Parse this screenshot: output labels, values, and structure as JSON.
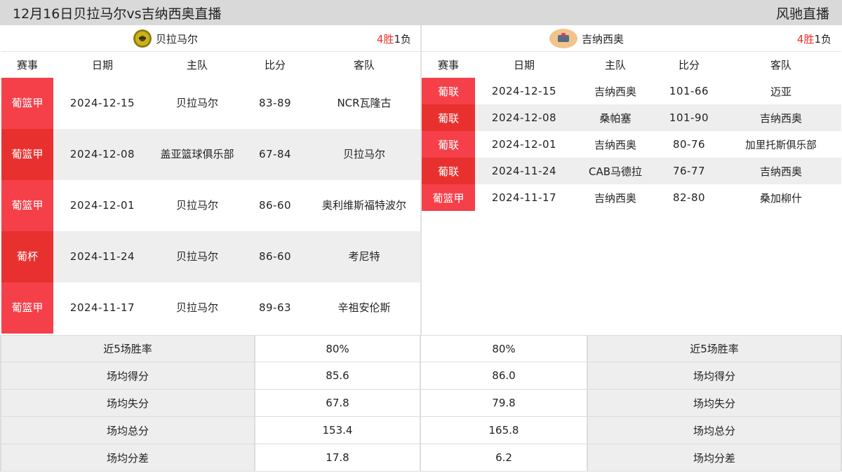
{
  "header": {
    "title": "12月16日贝拉马尔vs吉纳西奥直播",
    "brand": "风驰直播"
  },
  "columns": [
    "赛事",
    "日期",
    "主队",
    "比分",
    "客队"
  ],
  "left_team": {
    "name": "贝拉马尔",
    "logo_icon": "belamar-crest-icon",
    "record": {
      "wins": "4",
      "win_label": "胜",
      "losses": "1",
      "loss_label": "负"
    },
    "matches": [
      {
        "league": "葡篮甲",
        "date": "2024-12-15",
        "home": "贝拉马尔",
        "score": "83-89",
        "away": "NCR瓦隆古"
      },
      {
        "league": "葡篮甲",
        "date": "2024-12-08",
        "home": "盖亚篮球俱乐部",
        "score": "67-84",
        "away": "贝拉马尔"
      },
      {
        "league": "葡篮甲",
        "date": "2024-12-01",
        "home": "贝拉马尔",
        "score": "86-60",
        "away": "奥利维斯福特波尔"
      },
      {
        "league": "葡杯",
        "date": "2024-11-24",
        "home": "贝拉马尔",
        "score": "86-60",
        "away": "考尼特"
      },
      {
        "league": "葡篮甲",
        "date": "2024-11-17",
        "home": "贝拉马尔",
        "score": "89-63",
        "away": "辛祖安伦斯"
      }
    ]
  },
  "right_team": {
    "name": "吉纳西奥",
    "logo_icon": "guimar-crest-icon",
    "record": {
      "wins": "4",
      "win_label": "胜",
      "losses": "1",
      "loss_label": "负"
    },
    "matches": [
      {
        "league": "葡联",
        "date": "2024-12-15",
        "home": "吉纳西奥",
        "score": "101-66",
        "away": "迈亚"
      },
      {
        "league": "葡联",
        "date": "2024-12-08",
        "home": "桑帕塞",
        "score": "101-90",
        "away": "吉纳西奥"
      },
      {
        "league": "葡联",
        "date": "2024-12-01",
        "home": "吉纳西奥",
        "score": "80-76",
        "away": "加里托斯俱乐部"
      },
      {
        "league": "葡联",
        "date": "2024-11-24",
        "home": "CAB马德拉",
        "score": "76-77",
        "away": "吉纳西奥"
      },
      {
        "league": "葡篮甲",
        "date": "2024-11-17",
        "home": "吉纳西奥",
        "score": "82-80",
        "away": "桑加柳什"
      }
    ]
  },
  "stats": [
    {
      "label": "近5场胜率",
      "left": "80%",
      "right": "80%"
    },
    {
      "label": "场均得分",
      "left": "85.6",
      "right": "86.0"
    },
    {
      "label": "场均失分",
      "left": "67.8",
      "right": "79.8"
    },
    {
      "label": "场均总分",
      "left": "153.4",
      "right": "165.8"
    },
    {
      "label": "场均分差",
      "left": "17.8",
      "right": "6.2"
    }
  ],
  "colors": {
    "badge_red": "#f5404a",
    "badge_red_alt": "#e8312f",
    "win_red": "#e8342c",
    "header_gray": "#d9d9d9",
    "row_alt": "#efeeee"
  }
}
